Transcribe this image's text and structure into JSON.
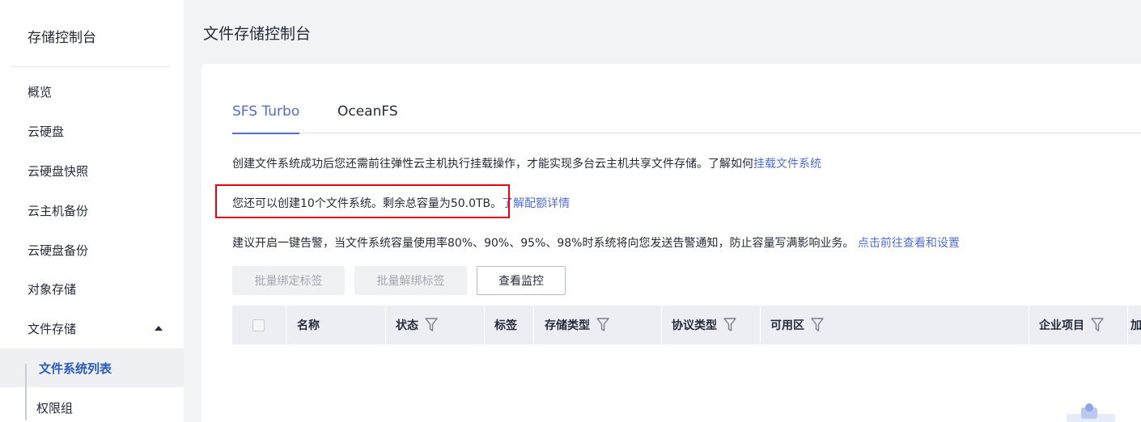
{
  "sidebar": {
    "title": "存储控制台",
    "items": [
      {
        "label": "概览"
      },
      {
        "label": "云硬盘"
      },
      {
        "label": "云硬盘快照"
      },
      {
        "label": "云主机备份"
      },
      {
        "label": "云硬盘备份"
      },
      {
        "label": "对象存储"
      },
      {
        "label": "文件存储"
      }
    ],
    "sub_items": [
      {
        "label": "文件系统列表",
        "active": true
      },
      {
        "label": "权限组"
      }
    ]
  },
  "header": {
    "title": "文件存储控制台"
  },
  "tabs": [
    {
      "label": "SFS Turbo",
      "active": true
    },
    {
      "label": "OceanFS"
    }
  ],
  "info": {
    "line1_text": "创建文件系统成功后您还需前往弹性云主机执行挂载操作，才能实现多台云主机共享文件存储。了解如何",
    "line1_link": "挂载文件系统",
    "line2_text": "您还可以创建10个文件系统。剩余总容量为50.0TB。",
    "line2_link": "了解配额详情",
    "line3_text": "建议开启一键告警，当文件系统容量使用率80%、90%、95%、98%时系统将向您发送告警通知，防止容量写满影响业务。",
    "line3_link": "点击前往查看和设置"
  },
  "toolbar": {
    "bind_tag": "批量绑定标签",
    "unbind_tag": "批量解绑标签",
    "view_monitor": "查看监控"
  },
  "table": {
    "columns": [
      {
        "label": "名称"
      },
      {
        "label": "状态"
      },
      {
        "label": "标签"
      },
      {
        "label": "存储类型"
      },
      {
        "label": "协议类型"
      },
      {
        "label": "可用区"
      },
      {
        "label": "企业项目"
      },
      {
        "label": "加"
      }
    ]
  },
  "colors": {
    "accent": "#526ecc",
    "highlight": "#e60012",
    "active_nav": "#2b5ab8"
  }
}
